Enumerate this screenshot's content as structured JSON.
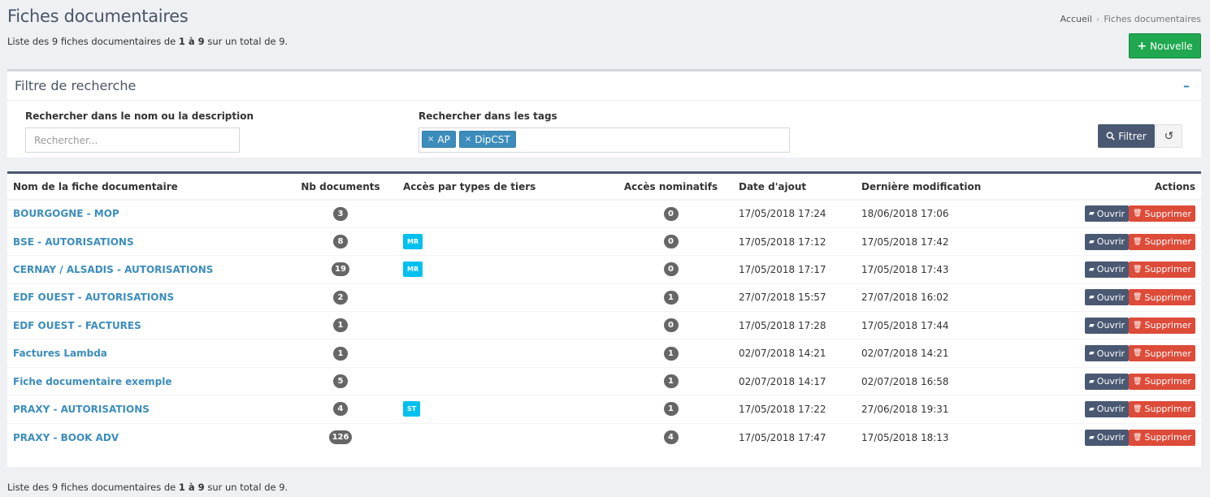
{
  "header": {
    "title": "Fiches documentaires",
    "breadcrumb": {
      "home": "Accueil",
      "current": "Fiches documentaires"
    },
    "new_button": "Nouvelle"
  },
  "summary": {
    "prefix": "Liste des 9 fiches documentaires de ",
    "range": "1 à 9",
    "suffix": " sur un total de 9."
  },
  "filter": {
    "title": "Filtre de recherche",
    "collapse": "–",
    "search_label": "Rechercher dans le nom ou la description",
    "search_placeholder": "Rechercher...",
    "tags_label": "Rechercher dans les tags",
    "tags": [
      "AP",
      "DipCST"
    ],
    "filter_button": "Filtrer"
  },
  "table": {
    "headers": [
      "Nom de la fiche documentaire",
      "Nb documents",
      "Accès par types de tiers",
      "Accès nominatifs",
      "Date d'ajout",
      "Dernière modification",
      "Actions"
    ],
    "open_label": "Ouvrir",
    "delete_label": "Supprimer",
    "rows": [
      {
        "name": "BOURGOGNE - MOP",
        "docs": "3",
        "tier": "",
        "nominatifs": "0",
        "added": "17/05/2018 17:24",
        "modified": "18/06/2018 17:06"
      },
      {
        "name": "BSE - AUTORISATIONS",
        "docs": "8",
        "tier": "MR",
        "nominatifs": "0",
        "added": "17/05/2018 17:12",
        "modified": "17/05/2018 17:42"
      },
      {
        "name": "CERNAY / ALSADIS - AUTORISATIONS",
        "docs": "19",
        "tier": "MR",
        "nominatifs": "0",
        "added": "17/05/2018 17:17",
        "modified": "17/05/2018 17:43"
      },
      {
        "name": "EDF OUEST - AUTORISATIONS",
        "docs": "2",
        "tier": "",
        "nominatifs": "1",
        "added": "27/07/2018 15:57",
        "modified": "27/07/2018 16:02"
      },
      {
        "name": "EDF OUEST - FACTURES",
        "docs": "1",
        "tier": "",
        "nominatifs": "0",
        "added": "17/05/2018 17:28",
        "modified": "17/05/2018 17:44"
      },
      {
        "name": "Factures Lambda",
        "docs": "1",
        "tier": "",
        "nominatifs": "1",
        "added": "02/07/2018 14:21",
        "modified": "02/07/2018 14:21"
      },
      {
        "name": "Fiche documentaire exemple",
        "docs": "5",
        "tier": "",
        "nominatifs": "1",
        "added": "02/07/2018 14:17",
        "modified": "02/07/2018 16:58"
      },
      {
        "name": "PRAXY - AUTORISATIONS",
        "docs": "4",
        "tier": "ST",
        "nominatifs": "1",
        "added": "17/05/2018 17:22",
        "modified": "27/06/2018 19:31"
      },
      {
        "name": "PRAXY - BOOK ADV",
        "docs": "126",
        "tier": "",
        "nominatifs": "4",
        "added": "17/05/2018 17:47",
        "modified": "17/05/2018 18:13"
      }
    ]
  }
}
